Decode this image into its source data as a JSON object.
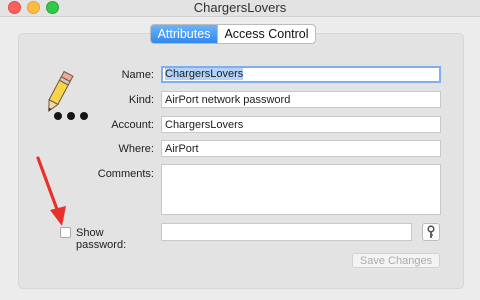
{
  "window": {
    "title": "ChargersLovers"
  },
  "tabs": [
    {
      "label": "Attributes",
      "selected": true
    },
    {
      "label": "Access Control",
      "selected": false
    }
  ],
  "form": {
    "name_label": "Name:",
    "name_value": "ChargersLovers",
    "kind_label": "Kind:",
    "kind_value": "AirPort network password",
    "account_label": "Account:",
    "account_value": "ChargersLovers",
    "where_label": "Where:",
    "where_value": "AirPort",
    "comments_label": "Comments:",
    "comments_value": "",
    "show_password_label": "Show password:",
    "show_password_checked": false,
    "password_value": ""
  },
  "buttons": {
    "save_label": "Save Changes",
    "save_enabled": false
  },
  "icons": {
    "app_icon": "pencil-ellipsis-icon",
    "key_button": "key-icon",
    "annotation": "red-arrow-icon"
  },
  "colors": {
    "accent": "#2f88f0",
    "selection": "#b3d3fd",
    "annotation": "#e8312a"
  }
}
